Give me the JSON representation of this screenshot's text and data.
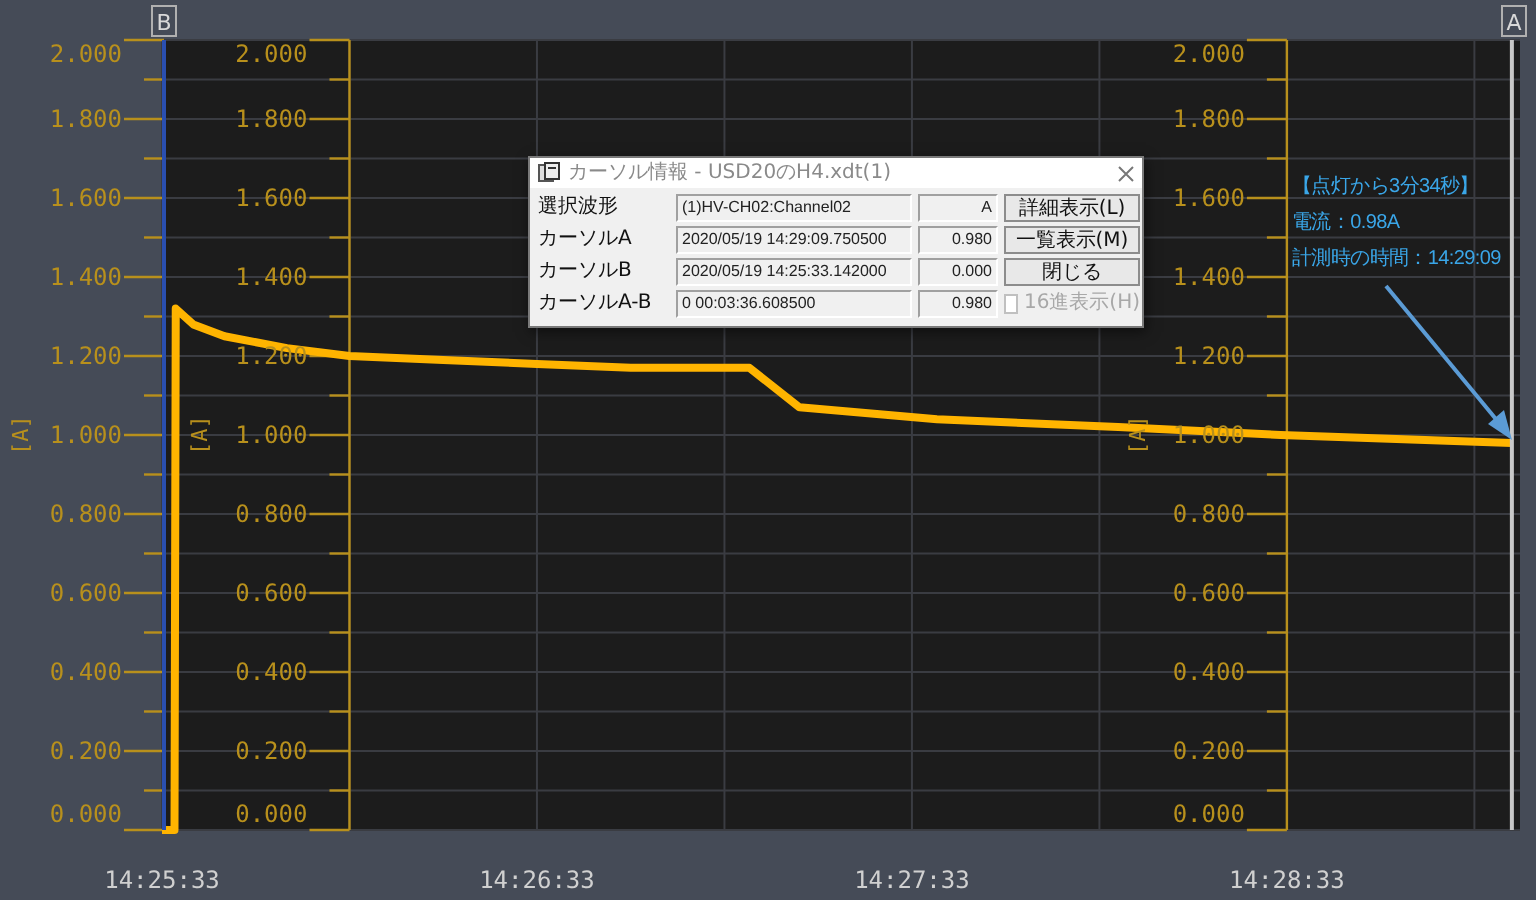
{
  "cursors": [
    {
      "label": "B",
      "color": "#2a4fb0"
    },
    {
      "label": "A"
    }
  ],
  "y_axes": [
    {
      "unit": "[A]",
      "labels": [
        "2.000",
        "1.800",
        "1.600",
        "1.400",
        "1.200",
        "1.000",
        "0.800",
        "0.600",
        "0.400",
        "0.200",
        "0.000"
      ]
    },
    {
      "unit": "[A]",
      "labels": [
        "2.000",
        "1.800",
        "1.600",
        "1.400",
        "1.200",
        "1.000",
        "0.800",
        "0.600",
        "0.400",
        "0.200",
        "0.000"
      ]
    }
  ],
  "chart_data": {
    "type": "line",
    "ylabel": "[A]",
    "grid": true,
    "ref_lines": [
      {
        "axis": "x",
        "value": 51963,
        "color": "#b8901c"
      },
      {
        "axis": "x",
        "value": 52113,
        "color": "#b8901c"
      },
      {
        "axis": "x",
        "value": 52149,
        "color": "#c8c8c8"
      }
    ],
    "xlim": [
      51933,
      52150.3
    ],
    "ylim": [
      0,
      2
    ],
    "xticks": [
      {
        "value": 51933,
        "label": "14:25:33"
      },
      {
        "value": 51993,
        "label": "14:26:33"
      },
      {
        "value": 52053,
        "label": "14:27:33"
      },
      {
        "value": 52113,
        "label": "14:28:33"
      }
    ],
    "yticks": [
      {
        "value": 2,
        "label": "2.000"
      },
      {
        "value": 1.8,
        "label": "1.800"
      },
      {
        "value": 1.6,
        "label": "1.600"
      },
      {
        "value": 1.4,
        "label": "1.400"
      },
      {
        "value": 1.2,
        "label": "1.200"
      },
      {
        "value": 1,
        "label": "1.000"
      },
      {
        "value": 0.8,
        "label": "0.800"
      },
      {
        "value": 0.6,
        "label": "0.600"
      },
      {
        "value": 0.4,
        "label": "0.400"
      },
      {
        "value": 0.2,
        "label": "0.200"
      },
      {
        "value": 0,
        "label": "0.000"
      }
    ],
    "x": [
      51933,
      51935,
      51935.2,
      51938,
      51943,
      51953,
      51963,
      51978,
      51993,
      52008,
      52027,
      52035,
      52057,
      52086,
      52112,
      52149
    ],
    "series": [
      {
        "color": "#ffb400",
        "values": [
          0,
          0,
          1.32,
          1.28,
          1.25,
          1.22,
          1.2,
          1.19,
          1.18,
          1.17,
          1.17,
          1.07,
          1.04,
          1.02,
          1.0,
          0.98
        ]
      }
    ]
  },
  "cursor_dialog": {
    "title": "カーソル情報 - USD20のH4.xdt(1)",
    "rows": [
      {
        "label": "選択波形",
        "value": "(1)HV-CH02:Channel02",
        "reading": "A"
      },
      {
        "label": "カーソルA",
        "value": "2020/05/19 14:29:09.750500",
        "reading": "0.980"
      },
      {
        "label": "カーソルB",
        "value": "2020/05/19 14:25:33.142000",
        "reading": "0.000"
      },
      {
        "label": "カーソルA-B",
        "value": "0 00:03:36.608500",
        "reading": "0.980"
      }
    ],
    "buttons": [
      {
        "label": "詳細表示(L)"
      },
      {
        "label": "一覧表示(M)"
      },
      {
        "label": "閉じる"
      }
    ],
    "hex_checkbox": {
      "label": "16進表示(H)",
      "checked": false,
      "disabled": true
    }
  },
  "callout": {
    "lines": [
      "【点灯から3分34秒】",
      "電流：0.98A",
      "計測時の時間：14:29:09"
    ]
  }
}
